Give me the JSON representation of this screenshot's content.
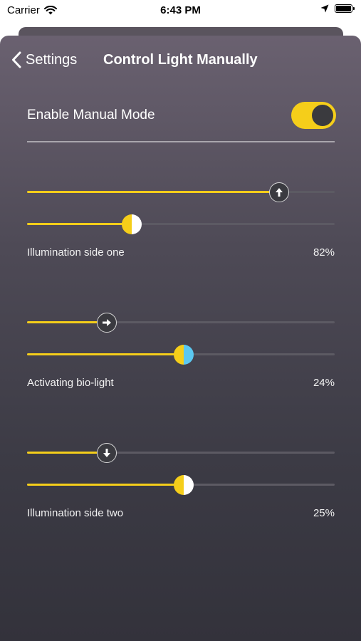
{
  "status_bar": {
    "carrier": "Carrier",
    "time": "6:43 PM",
    "icons": [
      "wifi-icon",
      "location-arrow-icon",
      "battery-icon"
    ]
  },
  "nav": {
    "back_label": "Settings",
    "title": "Control Light Manually"
  },
  "manual_mode": {
    "label": "Enable Manual Mode",
    "enabled": true
  },
  "colors": {
    "accent": "#f5ce1a",
    "bio_accent": "#5bc8f0",
    "track": "#5c5a63"
  },
  "controls": [
    {
      "name": "Illumination side one",
      "percent_label": "82%",
      "direction_icon": "arrow-up-icon",
      "direction_value": 0.82,
      "level_value": 0.34,
      "thumb_colors": [
        "#f5ce1a",
        "#ffffff"
      ]
    },
    {
      "name": "Activating bio-light",
      "percent_label": "24%",
      "direction_icon": "arrow-right-icon",
      "direction_value": 0.26,
      "level_value": 0.51,
      "thumb_colors": [
        "#f5ce1a",
        "#5bc8f0"
      ]
    },
    {
      "name": "Illumination side two",
      "percent_label": "25%",
      "direction_icon": "arrow-down-icon",
      "direction_value": 0.26,
      "level_value": 0.51,
      "thumb_colors": [
        "#f5ce1a",
        "#ffffff"
      ]
    }
  ]
}
